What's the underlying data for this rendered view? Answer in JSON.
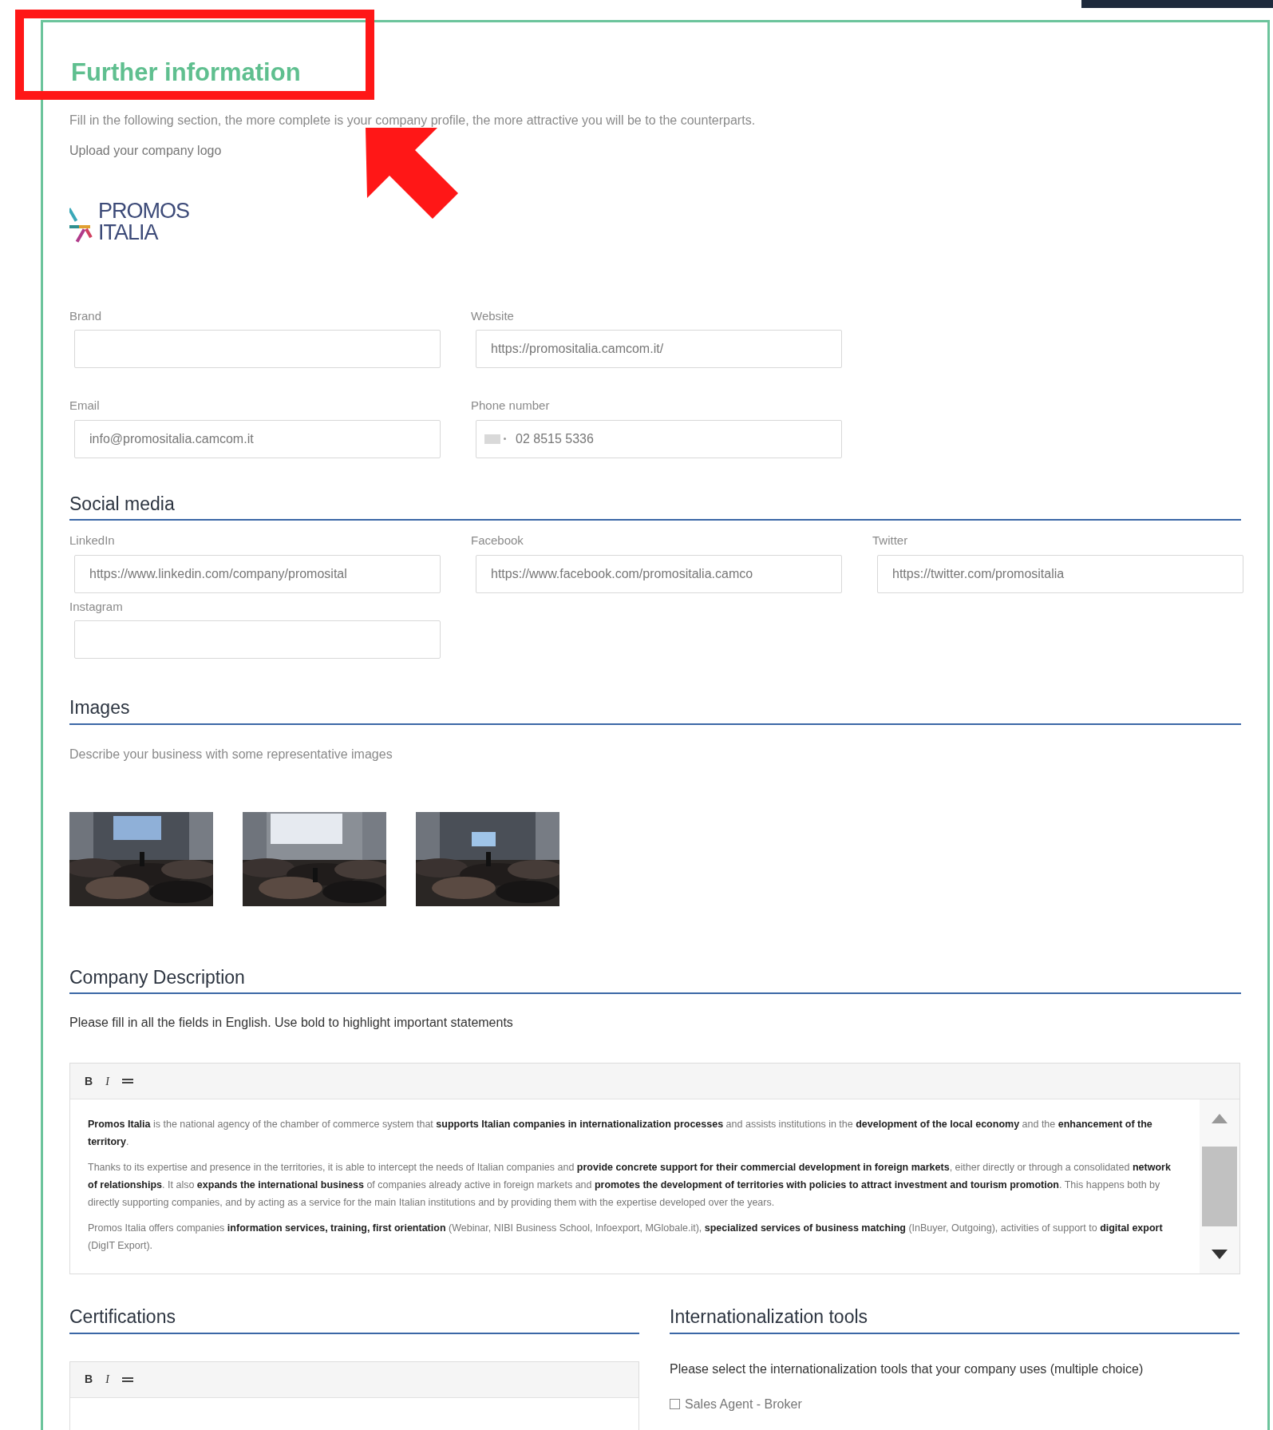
{
  "title": "Further information",
  "intro": "Fill in the following section, the more complete is your company profile, the more attractive you will be to the counterparts.",
  "logo_prompt": "Upload your company logo",
  "logo": {
    "line1": "PROMOS",
    "line2": "ITALIA"
  },
  "fields": [
    {
      "kind": "text",
      "label": "Brand"
    },
    {
      "kind": "text",
      "label": "Website",
      "value": "https://promositalia.camcom.it/"
    },
    {
      "kind": "text",
      "label": "Email",
      "value": "info@promositalia.camcom.it"
    },
    {
      "kind": "phone",
      "label": "Phone number",
      "value": "02 8515 5336"
    }
  ],
  "social_media": {
    "heading": "Social media",
    "fields": [
      {
        "label": "LinkedIn",
        "value": "https://www.linkedin.com/company/promosital"
      },
      {
        "label": "Facebook",
        "value": "https://www.facebook.com/promositalia.camco"
      },
      {
        "label": "Twitter",
        "value": "https://twitter.com/promositalia"
      },
      {
        "label": "Instagram"
      }
    ]
  },
  "images": {
    "heading": "Images",
    "text": "Describe your business with some representative images"
  },
  "company_description": {
    "heading": "Company Description",
    "note": "Please fill in all the fields in English. Use bold to highlight important statements",
    "toolbar": [
      "B",
      "I"
    ],
    "paragraphs": [
      "**Promos Italia** is the national agency of the chamber of commerce system that **supports Italian companies in internationalization processes** and assists institutions in the **development of the local economy** and the **enhancement of the territory**.",
      "Thanks to its expertise and presence in the territories, it is able to intercept the needs of Italian companies and **provide concrete support for their commercial development in foreign markets**, either directly or through a consolidated **network of relationships**. It also **expands the international business** of companies already active in foreign markets and **promotes the development of territories with policies to attract investment and tourism promotion**. This happens both by directly supporting companies, and by acting as a service for the main Italian institutions and by providing them with the expertise developed over the years.",
      "Promos Italia offers companies **information services, training, first orientation** (Webinar, NIBI Business School, Infoexport, MGlobale.it), **specialized services of business matching** (InBuyer, Outgoing), activities of support to **digital export** (DigIT Export)."
    ]
  },
  "certifications": {
    "heading": "Certifications",
    "toolbar": [
      "B",
      "I"
    ]
  },
  "tools": {
    "heading": "Internationalization tools",
    "note": "Please select the internationalization tools that your company uses (multiple choice)",
    "options": [
      {
        "label": "Sales Agent - Broker",
        "checked": false
      }
    ]
  }
}
